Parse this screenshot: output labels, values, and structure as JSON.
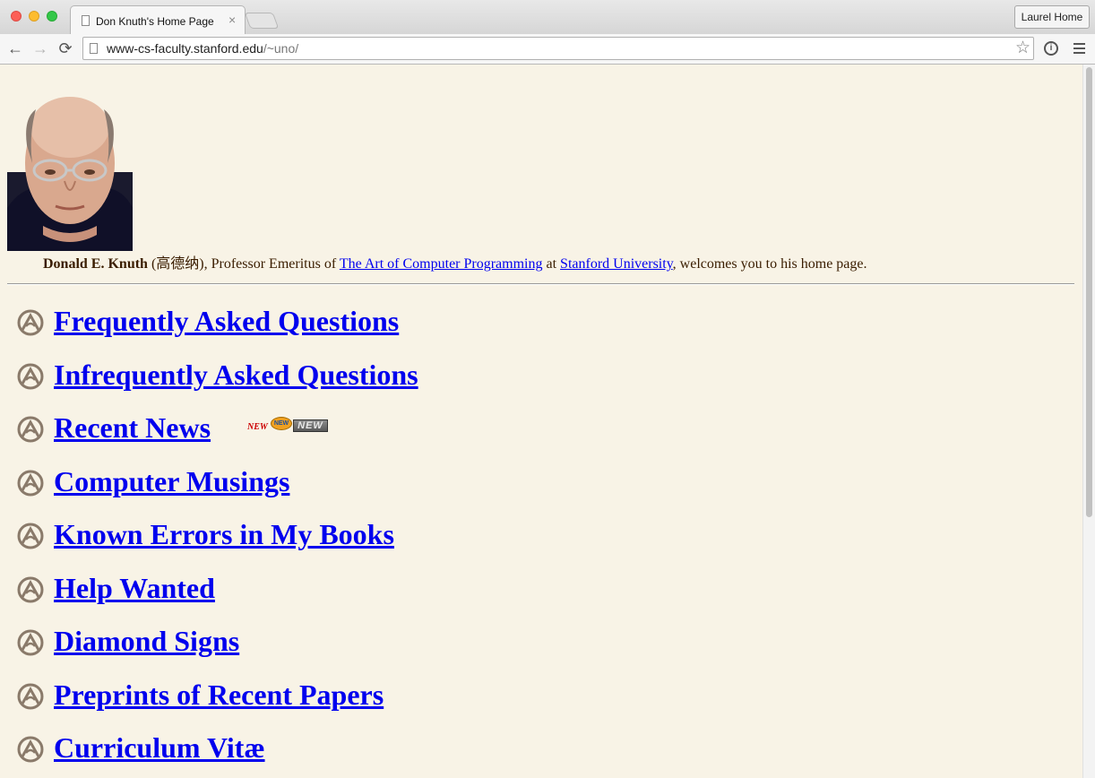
{
  "browser": {
    "tab_title": "Don Knuth's Home Page",
    "tab_close": "×",
    "profile_button": "Laurel Home",
    "url_host": "www-cs-faculty.stanford.edu",
    "url_path": "/~uno/",
    "back_glyph": "←",
    "forward_glyph": "→",
    "reload_glyph": "⟳",
    "star_glyph": "☆",
    "info_glyph": "i"
  },
  "page": {
    "background": "#f8f3e6",
    "intro": {
      "name": "Donald E. Knuth",
      "open_paren": " (",
      "chinese_name": "高德纳",
      "after_name": "), Professor Emeritus of ",
      "taocp_link": "The Art of Computer Programming",
      "at": " at ",
      "stanford_link": "Stanford University",
      "tail": ", welcomes you to his home page."
    },
    "menu": [
      {
        "label": "Frequently Asked Questions"
      },
      {
        "label": "Infrequently Asked Questions"
      },
      {
        "label": "Recent News"
      },
      {
        "label": "Computer Musings"
      },
      {
        "label": "Known Errors in My Books"
      },
      {
        "label": "Help Wanted"
      },
      {
        "label": "Diamond Signs"
      },
      {
        "label": "Preprints of Recent Papers"
      },
      {
        "label": "Curriculum Vitæ"
      }
    ],
    "new_badges": {
      "red": "NEW",
      "orange": "NEW",
      "gray": "NEW"
    }
  }
}
